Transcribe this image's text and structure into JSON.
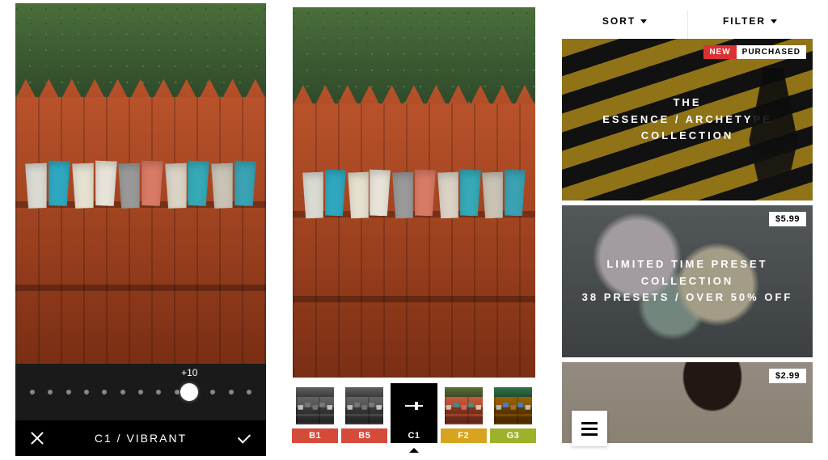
{
  "screen1": {
    "slider": {
      "value_label": "+10",
      "knob_position_pct": 72,
      "dot_count": 13
    },
    "preset_name": "C1 / VIBRANT",
    "cancel_icon": "x-icon",
    "confirm_icon": "check-icon"
  },
  "screen2": {
    "presets": [
      {
        "code": "B1",
        "tag_color": "#d54b3a",
        "variant": "bw"
      },
      {
        "code": "B5",
        "tag_color": "#d54b3a",
        "variant": "bw"
      },
      {
        "code": "C1",
        "tag_color": "#000000",
        "variant": "active"
      },
      {
        "code": "F2",
        "tag_color": "#d8a31e",
        "variant": "warm"
      },
      {
        "code": "G3",
        "tag_color": "#9fb12b",
        "variant": "green"
      }
    ],
    "active_index": 2
  },
  "screen3": {
    "sort_label": "SORT",
    "filter_label": "FILTER",
    "menu_icon": "hamburger-icon",
    "cards": [
      {
        "title": "THE\nESSENCE / ARCHETYPE\nCOLLECTION",
        "badge_new": "NEW",
        "badge_purchased": "PURCHASED"
      },
      {
        "title": "LIMITED TIME PRESET COLLECTION\n38 PRESETS / OVER 50% OFF",
        "price": "$5.99"
      },
      {
        "title": "",
        "price": "$2.99"
      }
    ]
  }
}
